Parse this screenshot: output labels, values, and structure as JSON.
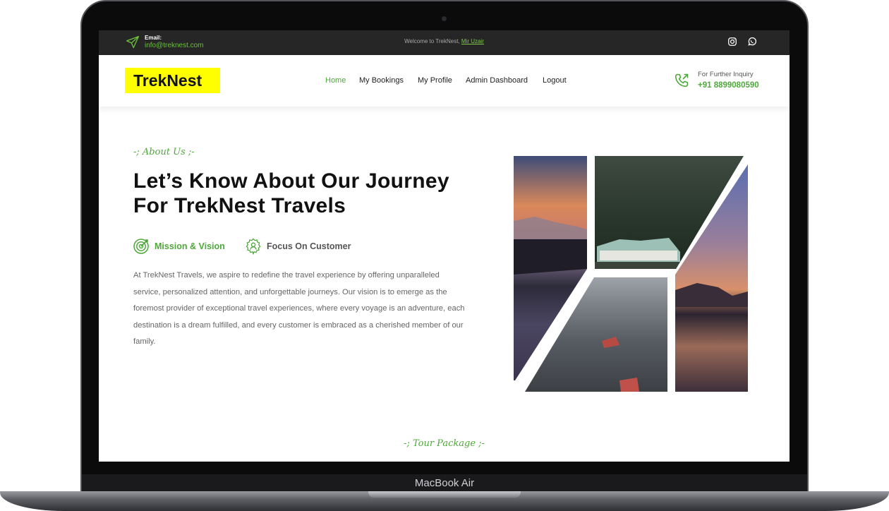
{
  "device": {
    "model_label": "MacBook Air"
  },
  "topbar": {
    "email_label": "Email:",
    "email": "info@treknest.com",
    "welcome_text": "Welcome to TrekNest, ",
    "welcome_user": "Mir Uzair",
    "icons": [
      "send-icon",
      "instagram-icon",
      "whatsapp-icon"
    ]
  },
  "navbar": {
    "logo": "TrekNest",
    "items": [
      {
        "label": "Home",
        "active": true
      },
      {
        "label": "My Bookings",
        "active": false
      },
      {
        "label": "My Profile",
        "active": false
      },
      {
        "label": "Admin Dashboard",
        "active": false
      },
      {
        "label": "Logout",
        "active": false
      }
    ],
    "inquiry_label": "For Further Inquiry",
    "inquiry_phone": "+91 8899080590"
  },
  "about": {
    "subtitle": "-; About Us ;-",
    "heading_line1": "Let’s Know About Our Journey",
    "heading_line2": "For TrekNest Travels",
    "features": [
      {
        "label": "Mission & Vision",
        "icon": "target-icon"
      },
      {
        "label": "Focus On Customer",
        "icon": "customer-badge-icon"
      }
    ],
    "paragraph": "At TrekNest Travels, we aspire to redefine the travel experience by offering unparalleled service, personalized attention, and unforgettable journeys. Our vision is to emerge as the foremost provider of exceptional travel experiences, where every voyage is an adventure, each destination is a dream fulfilled, and every customer is embraced as a cherished member of our family.",
    "collage_images": [
      "sunset-mountain-photo",
      "forest-lodge-photo",
      "aerial-town-photo",
      "lake-sunset-photo"
    ]
  },
  "tour": {
    "subtitle": "-; Tour Package ;-"
  },
  "colors": {
    "accent": "#4fa83b",
    "topbar": "#262626",
    "logo_bg": "#ffff00"
  }
}
